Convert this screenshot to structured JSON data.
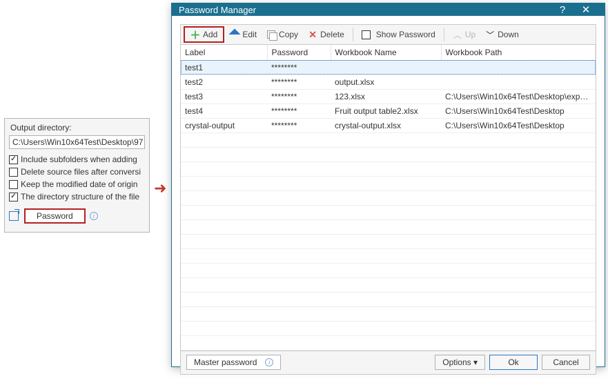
{
  "left": {
    "output_dir_label": "Output directory:",
    "output_dir_value": "C:\\Users\\Win10x64Test\\Desktop\\97",
    "opts": {
      "include": {
        "label": "Include subfolders when adding",
        "checked": true
      },
      "delete": {
        "label": "Delete source files after conversi",
        "checked": false
      },
      "keepdate": {
        "label": "Keep the modified date of origin",
        "checked": false
      },
      "dirstruct": {
        "label": "The directory structure of the file",
        "checked": true
      }
    },
    "password_btn": "Password"
  },
  "dialog": {
    "title": "Password Manager",
    "toolbar": {
      "add": "Add",
      "edit": "Edit",
      "copy": "Copy",
      "delete": "Delete",
      "show_pwd": "Show Password",
      "up": "Up",
      "down": "Down"
    },
    "columns": {
      "label": "Label",
      "password": "Password",
      "workbook": "Workbook Name",
      "path": "Workbook Path"
    },
    "rows": [
      {
        "label": "test1",
        "pwd": "********",
        "wb": "",
        "path": ""
      },
      {
        "label": "test2",
        "pwd": "********",
        "wb": "output.xlsx",
        "path": ""
      },
      {
        "label": "test3",
        "pwd": "********",
        "wb": "123.xlsx",
        "path": "C:\\Users\\Win10x64Test\\Desktop\\export..."
      },
      {
        "label": "test4",
        "pwd": "********",
        "wb": "Fruit output table2.xlsx",
        "path": "C:\\Users\\Win10x64Test\\Desktop"
      },
      {
        "label": "crystal-output",
        "pwd": "********",
        "wb": "crystal-output.xlsx",
        "path": "C:\\Users\\Win10x64Test\\Desktop"
      }
    ],
    "footer": {
      "master_pwd": "Master password",
      "options": "Options",
      "ok": "Ok",
      "cancel": "Cancel"
    }
  }
}
